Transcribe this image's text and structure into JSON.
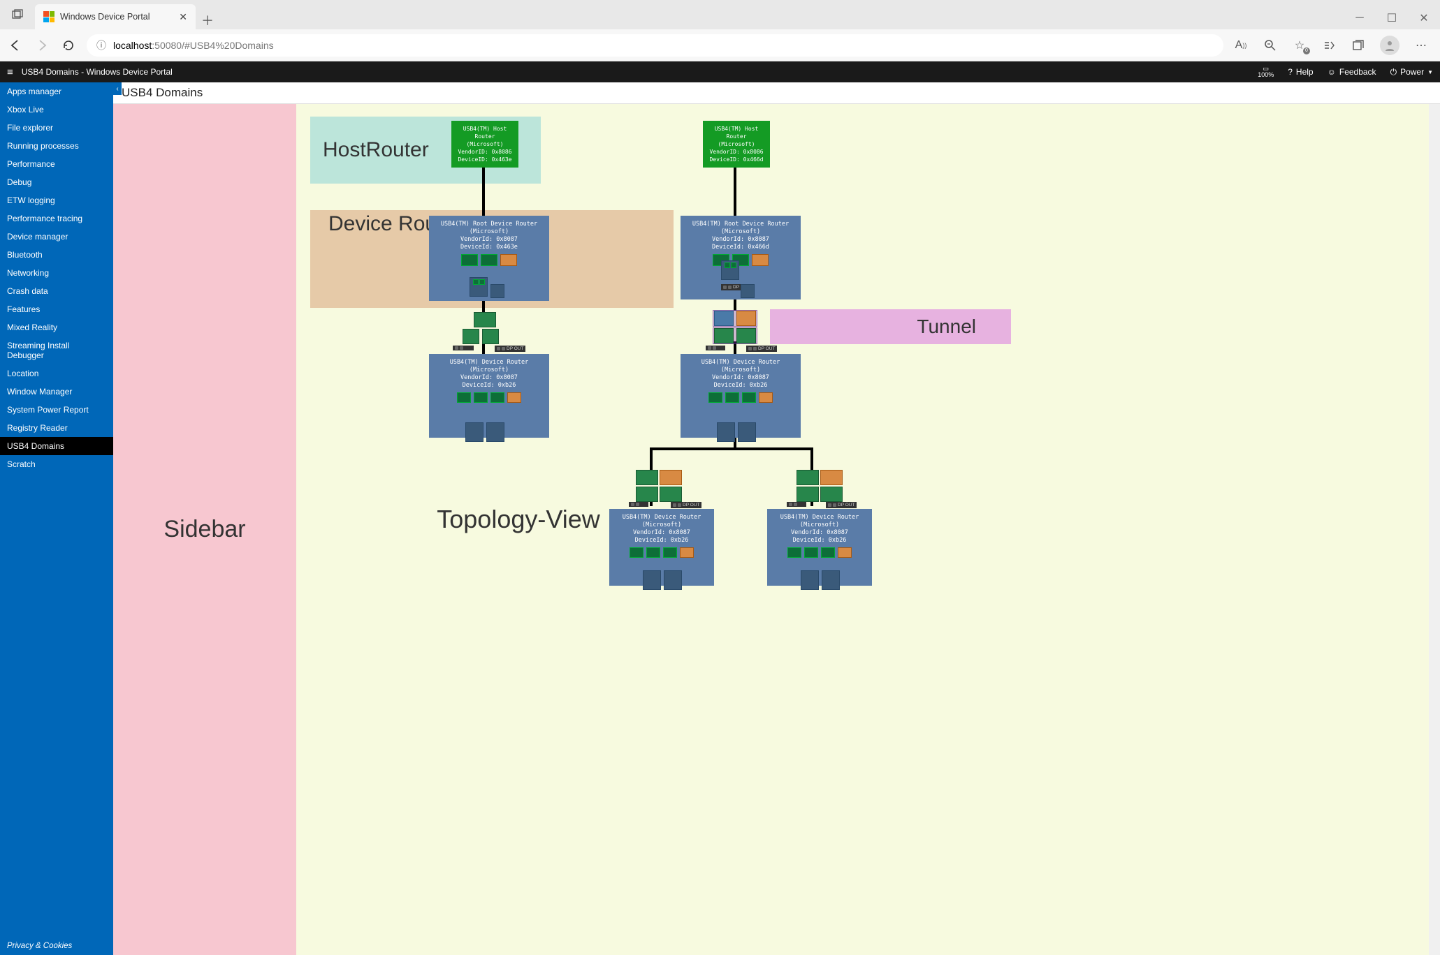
{
  "browser": {
    "tab_title": "Windows Device Portal",
    "url_host": "localhost",
    "url_port": ":50080",
    "url_path": "/#USB4%20Domains"
  },
  "appbar": {
    "title": "USB4 Domains - Windows Device Portal",
    "zoom": "100%",
    "help": "Help",
    "feedback": "Feedback",
    "power": "Power"
  },
  "sidebar": {
    "items": [
      "Apps manager",
      "Xbox Live",
      "File explorer",
      "Running processes",
      "Performance",
      "Debug",
      "ETW logging",
      "Performance tracing",
      "Device manager",
      "Bluetooth",
      "Networking",
      "Crash data",
      "Features",
      "Mixed Reality",
      "Streaming Install Debugger",
      "Location",
      "Window Manager",
      "System Power Report",
      "Registry Reader",
      "USB4 Domains",
      "Scratch"
    ],
    "active_index": 19,
    "footer": "Privacy & Cookies"
  },
  "page": {
    "title": "USB4 Domains"
  },
  "overlays": {
    "sidebar": "Sidebar",
    "host": "HostRouter",
    "device": "Device Router",
    "tunnel": "Tunnel",
    "topology": "Topology-View"
  },
  "topology": {
    "left": {
      "host": {
        "lines": [
          "USB4(TM) Host Router",
          "(Microsoft)",
          "VendorID: 0x8086",
          "DeviceID: 0x463e"
        ]
      },
      "root": {
        "lines": [
          "USB4(TM) Root Device Router (Microsoft)",
          "VendorId: 0x8087",
          "DeviceId: 0x463e"
        ]
      },
      "dev": {
        "lines": [
          "USB4(TM) Device Router (Microsoft)",
          "VendorId: 0x8087",
          "DeviceId: 0xb26"
        ]
      }
    },
    "right": {
      "host": {
        "lines": [
          "USB4(TM) Host Router",
          "(Microsoft)",
          "VendorID: 0x8086",
          "DeviceID: 0x466d"
        ]
      },
      "root": {
        "lines": [
          "USB4(TM) Root Device Router (Microsoft)",
          "VendorId: 0x8087",
          "DeviceId: 0x466d"
        ]
      },
      "dev": {
        "lines": [
          "USB4(TM) Device Router (Microsoft)",
          "VendorId: 0x8087",
          "DeviceId: 0xb26"
        ]
      },
      "leafL": {
        "lines": [
          "USB4(TM) Device Router (Microsoft)",
          "VendorId: 0x8087",
          "DeviceId: 0xb26"
        ]
      },
      "leafR": {
        "lines": [
          "USB4(TM) Device Router (Microsoft)",
          "VendorId: 0x8087",
          "DeviceId: 0xb26"
        ]
      }
    },
    "labels": {
      "dp_out": "DP OUT",
      "dp_in": "DP IN"
    }
  }
}
